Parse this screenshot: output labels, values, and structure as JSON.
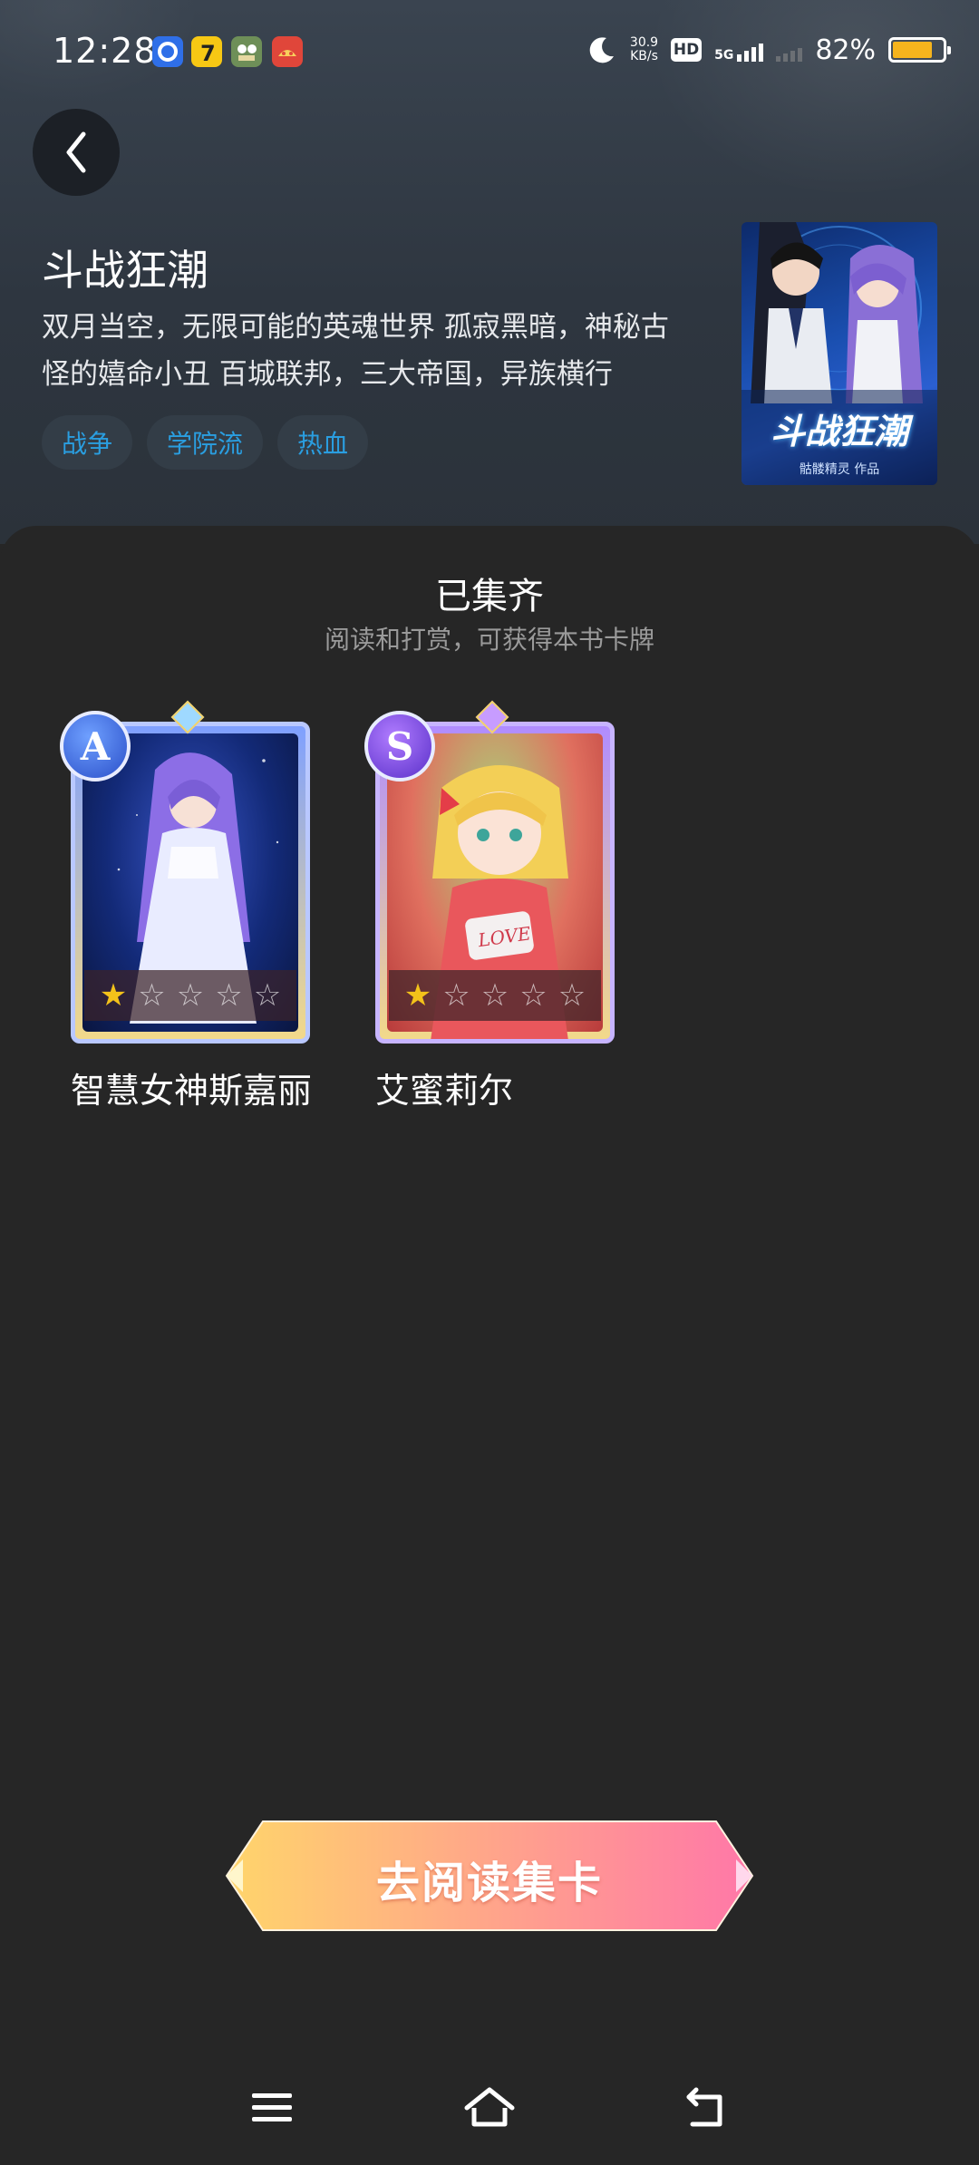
{
  "status_bar": {
    "time": "12:28",
    "net_speed_value": "30.9",
    "net_speed_unit": "KB/s",
    "hd_label": "HD",
    "hd_sub": "1",
    "network_type": "5G",
    "battery_pct_text": "82%",
    "battery_level": 0.82,
    "battery_color": "#f6b41d",
    "notification_icons": [
      "app-icon-blue",
      "app-icon-yellow",
      "app-icon-game",
      "app-icon-red"
    ]
  },
  "book": {
    "title": "斗战狂潮",
    "description": "双月当空，无限可能的英魂世界 孤寂黑暗，神秘古怪的嬉命小丑 百城联邦，三大帝国，异族横行",
    "tags": [
      "战争",
      "学院流",
      "热血"
    ],
    "cover_title": "斗战狂潮",
    "cover_author": "骷髅精灵 作品",
    "tag_color": "#2a9ee0"
  },
  "collection": {
    "title": "已集齐",
    "subtitle": "阅读和打赏，可获得本书卡牌",
    "cards": [
      {
        "rank": "A",
        "name": "智慧女神斯嘉丽",
        "stars_filled": 1,
        "stars_total": 5
      },
      {
        "rank": "S",
        "name": "艾蜜莉尔",
        "stars_filled": 1,
        "stars_total": 5
      }
    ]
  },
  "cta": {
    "label": "去阅读集卡"
  },
  "nav_bar": {
    "icons": [
      "menu-icon",
      "home-icon",
      "back-nav-icon"
    ]
  }
}
